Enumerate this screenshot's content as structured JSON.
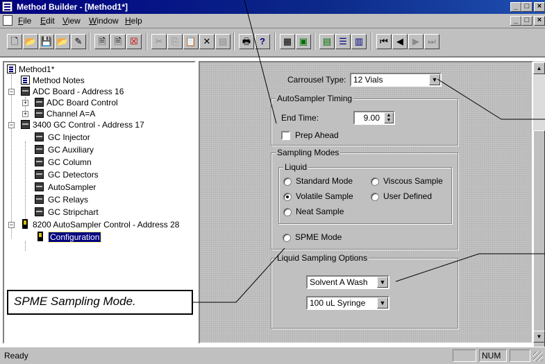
{
  "window": {
    "title": "Method Builder - [Method1*]",
    "min_glyph": "_",
    "max_glyph": "□",
    "close_glyph": "×",
    "restore_glyph": "🗗"
  },
  "menu": {
    "items": [
      "File",
      "Edit",
      "View",
      "Window",
      "Help"
    ],
    "mnemonics": [
      "F",
      "E",
      "V",
      "W",
      "H"
    ]
  },
  "toolbar": {
    "buttons": [
      {
        "name": "new-icon",
        "glyph": "🗋"
      },
      {
        "name": "open-icon",
        "glyph": "📂"
      },
      {
        "name": "save-icon",
        "glyph": "💾"
      },
      {
        "name": "open-folder-icon",
        "glyph": "📂"
      },
      {
        "name": "wizard-icon",
        "glyph": "✎"
      },
      {
        "name": "doc-a-icon",
        "glyph": "🗎"
      },
      {
        "name": "doc-b-icon",
        "glyph": "🗎"
      },
      {
        "name": "delete-doc-icon",
        "glyph": "☒"
      },
      {
        "name": "cut-icon",
        "glyph": "✂"
      },
      {
        "name": "copy-icon",
        "glyph": "⎘"
      },
      {
        "name": "paste-icon",
        "glyph": "📋"
      },
      {
        "name": "delete-icon",
        "glyph": "✕"
      },
      {
        "name": "properties-icon",
        "glyph": "▤"
      },
      {
        "name": "print-icon",
        "glyph": "🖶"
      },
      {
        "name": "help-icon",
        "glyph": "?"
      },
      {
        "name": "layout-a-icon",
        "glyph": "▦"
      },
      {
        "name": "layout-b-icon",
        "glyph": "▣"
      },
      {
        "name": "layout-c-icon",
        "glyph": "▤"
      },
      {
        "name": "layout-d-icon",
        "glyph": "☰"
      },
      {
        "name": "layout-e-icon",
        "glyph": "▥"
      },
      {
        "name": "first-icon",
        "glyph": "⏮"
      },
      {
        "name": "prev-icon",
        "glyph": "◀"
      },
      {
        "name": "next-icon",
        "glyph": "▶"
      },
      {
        "name": "last-icon",
        "glyph": "⏭"
      }
    ]
  },
  "tree": {
    "root": "Method1*",
    "items": [
      "Method Notes",
      "ADC Board - Address 16",
      "ADC Board Control",
      "Channel A=A",
      "3400 GC Control - Address 17",
      "GC Injector",
      "GC Auxiliary",
      "GC Column",
      "GC Detectors",
      "AutoSampler",
      "GC Relays",
      "GC Stripchart",
      "8200 AutoSampler Control - Address 28",
      "Configuration"
    ],
    "expander_minus": "−",
    "expander_plus": "+"
  },
  "form": {
    "carrousel_label": "Carrousel Type:",
    "carrousel_value": "12 Vials",
    "timing_group": "AutoSampler Timing",
    "endtime_label": "End Time:",
    "endtime_value": "9.00",
    "prep_ahead_label": "Prep Ahead",
    "sampling_modes_group": "Sampling Modes",
    "liquid_group": "Liquid",
    "radio_standard": "Standard Mode",
    "radio_viscous": "Viscous Sample",
    "radio_volatile": "Volatile Sample",
    "radio_user": "User Defined",
    "radio_neat": "Neat Sample",
    "radio_spme": "SPME Mode",
    "liquid_options_group": "Liquid Sampling Options",
    "solvent_value": "Solvent A Wash",
    "syringe_value": "100 uL Syringe",
    "combo_arrow": "▼"
  },
  "status": {
    "ready": "Ready",
    "num": "NUM"
  },
  "callout": {
    "text": "SPME Sampling Mode."
  },
  "scroll": {
    "up": "▲",
    "down": "▼"
  }
}
